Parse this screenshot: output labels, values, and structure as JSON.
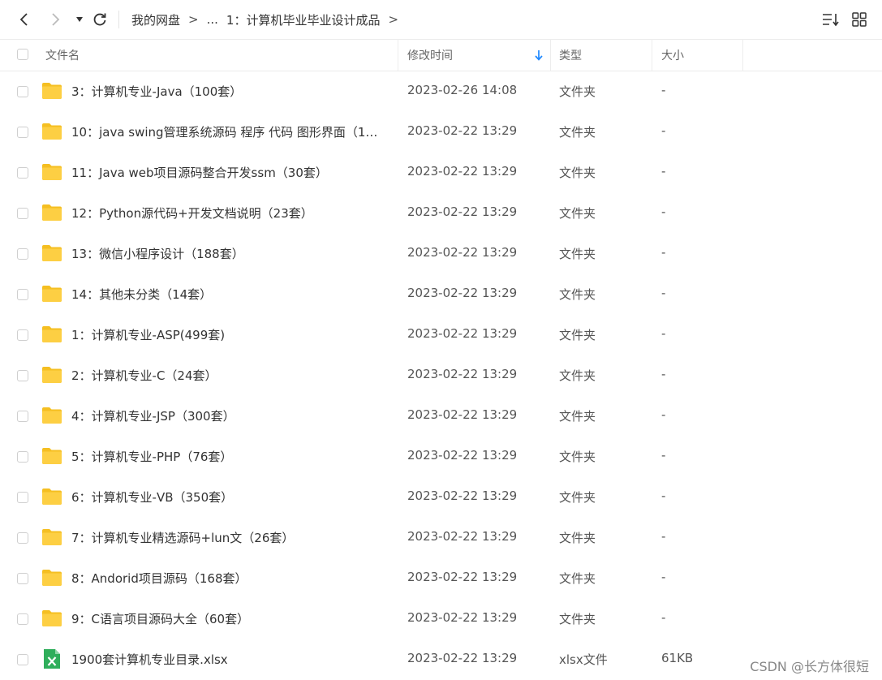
{
  "toolbar": {
    "back_icon": "chevron-left-icon",
    "forward_icon": "chevron-right-icon",
    "history_icon": "caret-down-icon",
    "refresh_icon": "refresh-icon",
    "sort_icon": "sort-list-icon",
    "grid_icon": "grid-view-icon"
  },
  "breadcrumb": {
    "root": "我的网盘",
    "arrow": ">",
    "ellipsis": "...",
    "current": "1：计算机毕业毕业设计成品"
  },
  "columns": {
    "name": "文件名",
    "modified": "修改时间",
    "type": "类型",
    "size": "大小",
    "sort_indicator_color": "#1e88ff"
  },
  "files": [
    {
      "name": "3：计算机专业-Java（100套）",
      "modified": "2023-02-26 14:08",
      "type": "文件夹",
      "size": "-",
      "icon": "folder"
    },
    {
      "name": "10：java swing管理系统源码 程序 代码 图形界面（11...",
      "modified": "2023-02-22 13:29",
      "type": "文件夹",
      "size": "-",
      "icon": "folder"
    },
    {
      "name": "11：Java web项目源码整合开发ssm（30套）",
      "modified": "2023-02-22 13:29",
      "type": "文件夹",
      "size": "-",
      "icon": "folder"
    },
    {
      "name": "12：Python源代码+开发文档说明（23套）",
      "modified": "2023-02-22 13:29",
      "type": "文件夹",
      "size": "-",
      "icon": "folder"
    },
    {
      "name": "13：微信小程序设计（188套）",
      "modified": "2023-02-22 13:29",
      "type": "文件夹",
      "size": "-",
      "icon": "folder"
    },
    {
      "name": "14：其他未分类（14套）",
      "modified": "2023-02-22 13:29",
      "type": "文件夹",
      "size": "-",
      "icon": "folder"
    },
    {
      "name": "1：计算机专业-ASP(499套)",
      "modified": "2023-02-22 13:29",
      "type": "文件夹",
      "size": "-",
      "icon": "folder"
    },
    {
      "name": "2：计算机专业-C（24套）",
      "modified": "2023-02-22 13:29",
      "type": "文件夹",
      "size": "-",
      "icon": "folder"
    },
    {
      "name": "4：计算机专业-JSP（300套）",
      "modified": "2023-02-22 13:29",
      "type": "文件夹",
      "size": "-",
      "icon": "folder"
    },
    {
      "name": "5：计算机专业-PHP（76套）",
      "modified": "2023-02-22 13:29",
      "type": "文件夹",
      "size": "-",
      "icon": "folder"
    },
    {
      "name": "6：计算机专业-VB（350套）",
      "modified": "2023-02-22 13:29",
      "type": "文件夹",
      "size": "-",
      "icon": "folder"
    },
    {
      "name": "7：计算机专业精选源码+lun文（26套）",
      "modified": "2023-02-22 13:29",
      "type": "文件夹",
      "size": "-",
      "icon": "folder"
    },
    {
      "name": "8：Andorid项目源码（168套）",
      "modified": "2023-02-22 13:29",
      "type": "文件夹",
      "size": "-",
      "icon": "folder"
    },
    {
      "name": "9：C语言项目源码大全（60套）",
      "modified": "2023-02-22 13:29",
      "type": "文件夹",
      "size": "-",
      "icon": "folder"
    },
    {
      "name": "1900套计算机专业目录.xlsx",
      "modified": "2023-02-22 13:29",
      "type": "xlsx文件",
      "size": "61KB",
      "icon": "xlsx"
    }
  ],
  "watermark": "CSDN @长方体很短",
  "colors": {
    "folder": "#fdcf43",
    "folder_dark": "#f5bf22",
    "xlsx": "#2fae5b"
  }
}
